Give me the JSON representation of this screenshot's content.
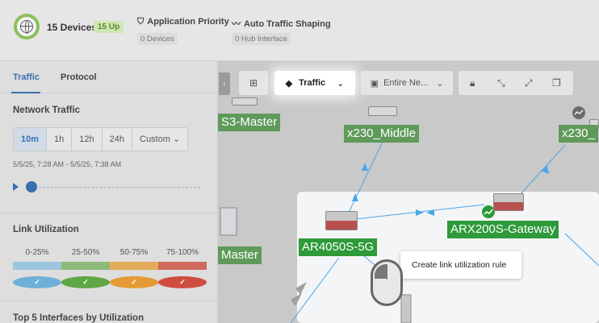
{
  "header": {
    "devices_label": "15 Devices",
    "up_badge": "15 Up",
    "app_priority": {
      "label": "Application Priority",
      "sub": "0 Devices"
    },
    "auto_shaping": {
      "label": "Auto Traffic Shaping",
      "sub": "0 Hub Interface"
    }
  },
  "left_panel": {
    "tabs": [
      {
        "label": "Traffic",
        "active": true
      },
      {
        "label": "Protocol",
        "active": false
      }
    ],
    "network_traffic": {
      "title": "Network Traffic",
      "time_buttons": [
        "10m",
        "1h",
        "12h",
        "24h",
        "Custom"
      ],
      "active_time": "10m",
      "date_range": "5/5/25, 7:28 AM - 5/5/25, 7:38 AM"
    },
    "link_utilization": {
      "title": "Link Utilization",
      "ranges": [
        {
          "label": "0-25%",
          "color": "#9cc5de",
          "check_color": "#6fb0d8"
        },
        {
          "label": "25-50%",
          "color": "#8fb97a",
          "check_color": "#5fa644"
        },
        {
          "label": "50-75%",
          "color": "#e3ac5a",
          "check_color": "#e59a35"
        },
        {
          "label": "75-100%",
          "color": "#cf6b5f",
          "check_color": "#cf4c3f"
        }
      ]
    },
    "top_interfaces_title": "Top 5 Interfaces by Utilization"
  },
  "toolbar": {
    "traffic_label": "Traffic",
    "scope_label": "Entire Ne..."
  },
  "map": {
    "nodes": [
      "S3-Master",
      "x230_Middle",
      "x230_",
      "ARX200S-Gateway",
      "AR4050S-5G",
      "Master"
    ],
    "tooltip": "Create link utilization rule"
  },
  "colors": {
    "accent": "#3a6fb0",
    "link_line": "#4aa7e6",
    "node_label_bg": "#2e9a3a"
  }
}
